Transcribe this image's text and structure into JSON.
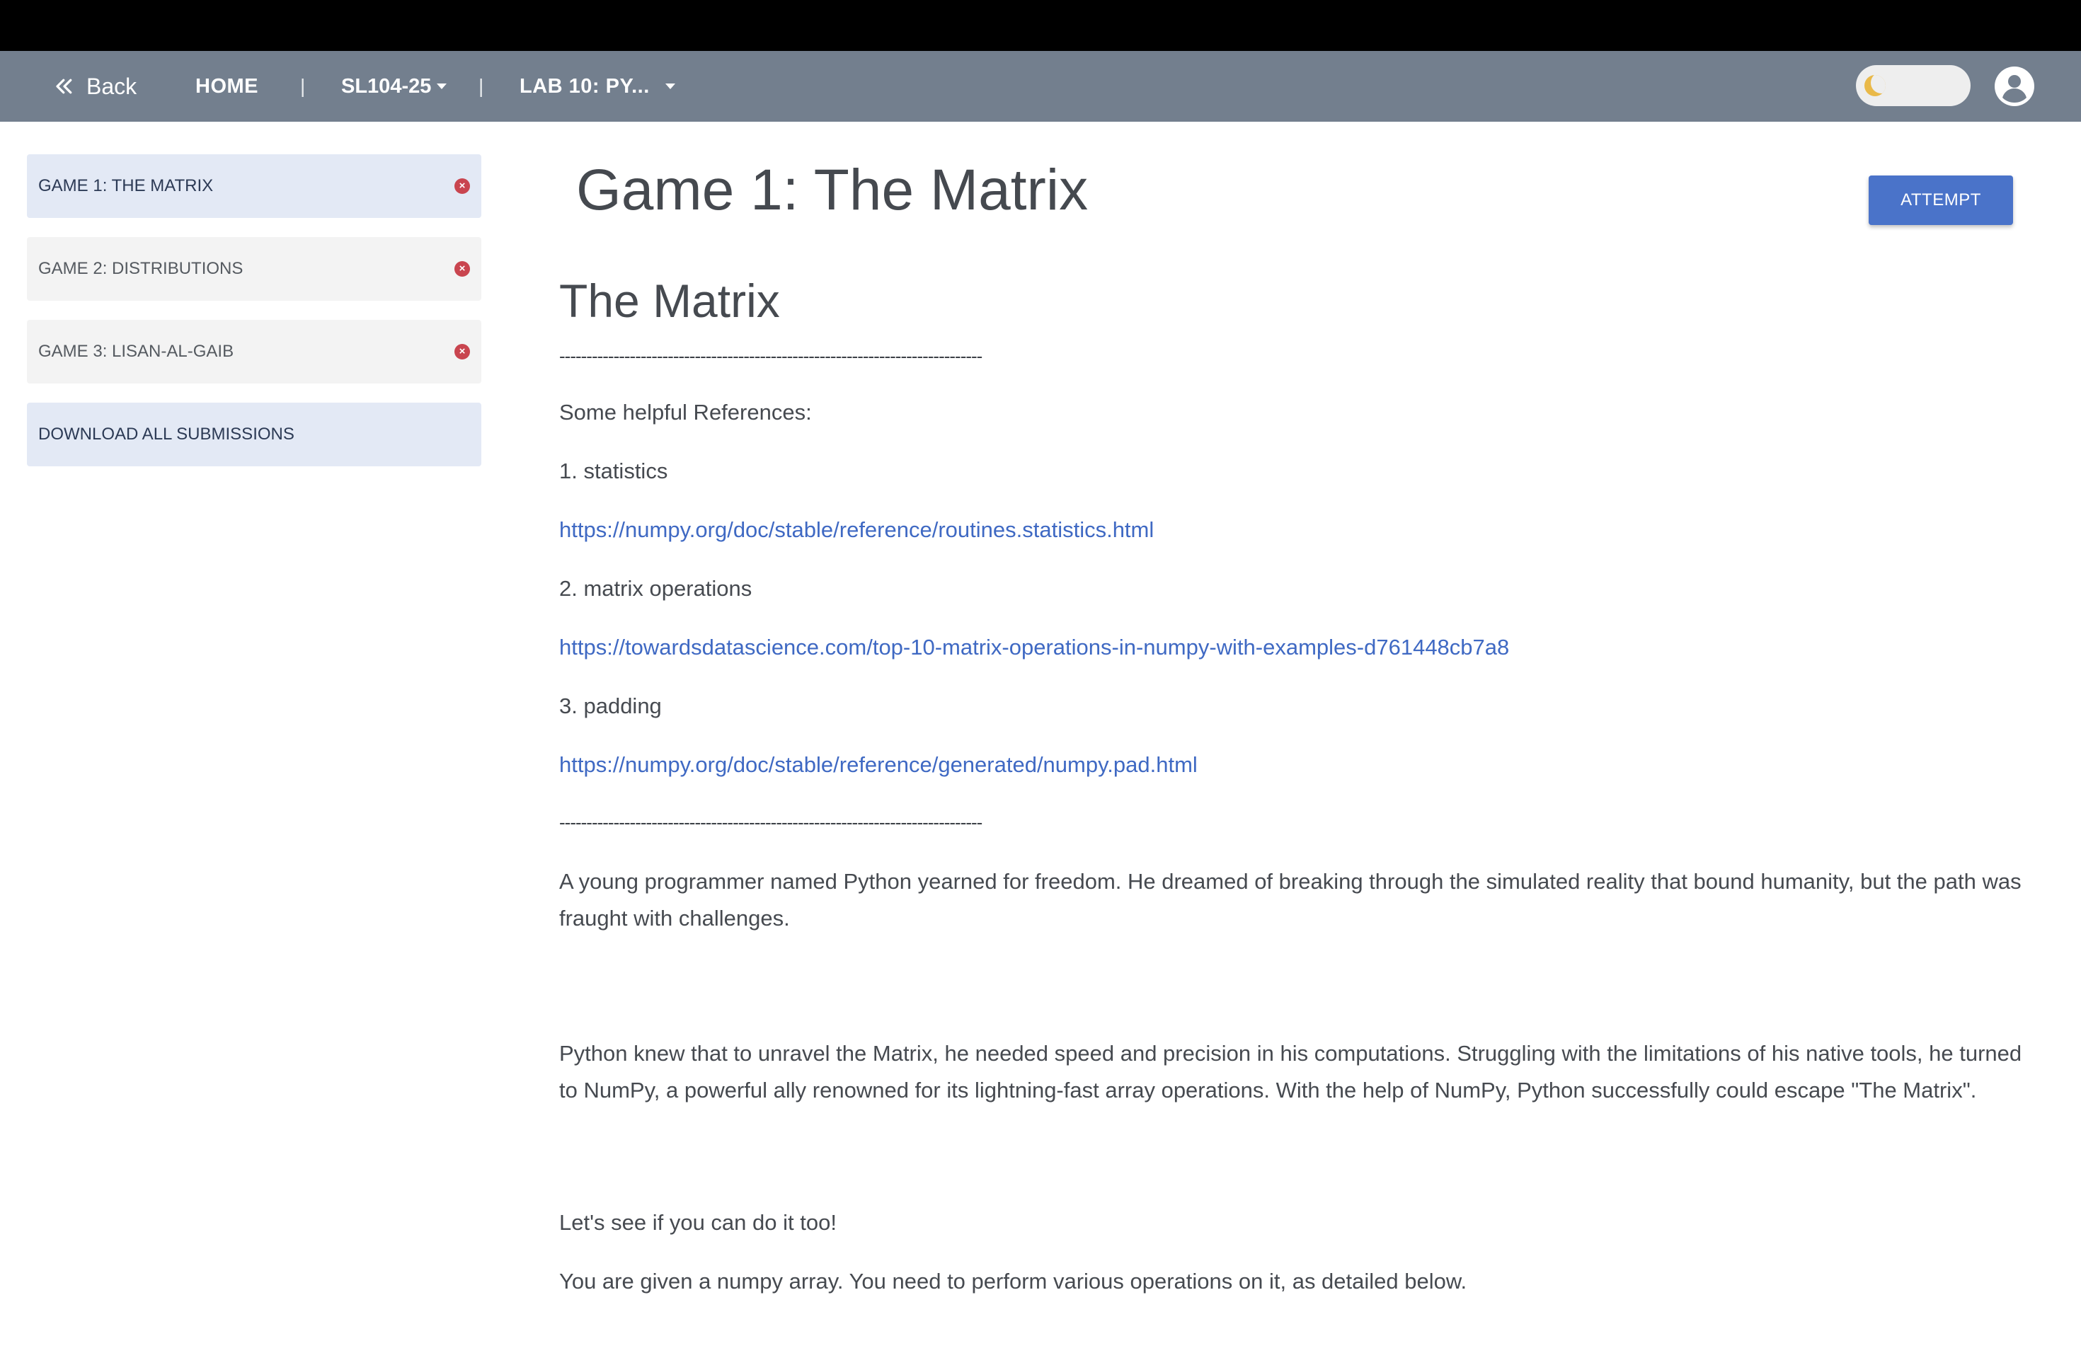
{
  "navbar": {
    "back_label": "Back",
    "home_label": "HOME",
    "separator": "|",
    "course_label": "SL104-25",
    "lab_label": "LAB 10: PY..."
  },
  "sidebar": {
    "items": [
      {
        "label": "GAME 1: THE MATRIX",
        "status": "×"
      },
      {
        "label": "GAME 2: DISTRIBUTIONS",
        "status": "×"
      },
      {
        "label": "GAME 3: LISAN-AL-GAIB",
        "status": "×"
      }
    ],
    "download_label": "DOWNLOAD ALL SUBMISSIONS"
  },
  "main": {
    "title": "Game 1: The Matrix",
    "attempt_label": "ATTEMPT",
    "heading": "The Matrix",
    "divider": "------------------------------------------------------------------------------",
    "refs_intro": "Some helpful References:",
    "ref1_label": "1. statistics",
    "ref1_url": "https://numpy.org/doc/stable/reference/routines.statistics.html",
    "ref2_label": "2. matrix operations",
    "ref2_url": "https://towardsdatascience.com/top-10-matrix-operations-in-numpy-with-examples-d761448cb7a8",
    "ref3_label": "3. padding",
    "ref3_url": "https://numpy.org/doc/stable/reference/generated/numpy.pad.html",
    "story1": "A young programmer named Python yearned for freedom. He dreamed of breaking through the simulated reality that bound humanity, but the path was fraught with challenges.",
    "story2": "Python knew that to unravel the Matrix, he needed speed and precision in his computations. Struggling with the limitations of his native tools, he turned to NumPy, a powerful ally renowned for its lightning-fast array operations. With the help of NumPy, Python successfully could escape \"The Matrix\".",
    "story3": "Let's see if you can do it too!",
    "story4": "You are given a numpy array. You need to perform various operations on it, as detailed below."
  },
  "colors": {
    "navbar": "#737f8e",
    "accent": "#4a73c9",
    "link": "#3f69c3",
    "status_error": "#c9454f",
    "active_item": "#e3e9f5"
  },
  "icons": [
    "chevron-double-left-icon",
    "caret-down-icon",
    "moon-icon",
    "user-avatar-icon",
    "close-circle-icon"
  ]
}
